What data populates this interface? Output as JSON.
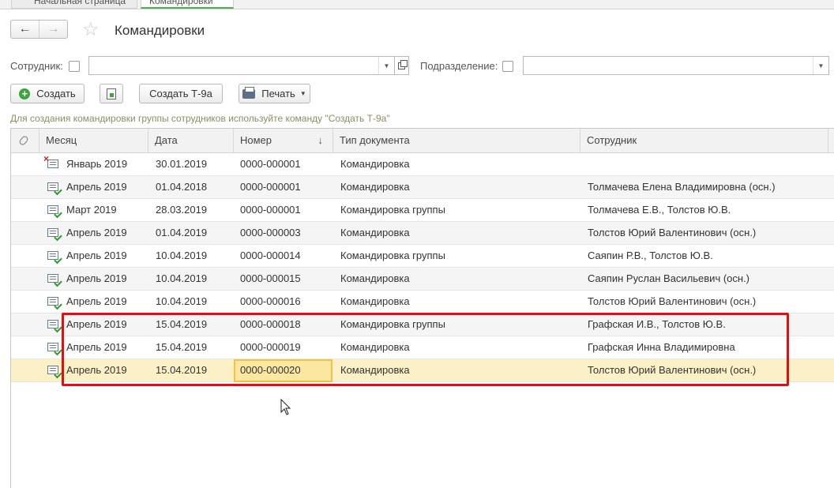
{
  "tabs": [
    {
      "label": "Начальная страница"
    },
    {
      "label": "Командировки"
    }
  ],
  "page": {
    "title": "Командировки"
  },
  "filters": {
    "employee_label": "Сотрудник:",
    "employee_value": "",
    "department_label": "Подразделение:",
    "department_value": ""
  },
  "toolbar": {
    "create_label": "Создать",
    "create_t9a_label": "Создать Т-9а",
    "print_label": "Печать"
  },
  "hint": "Для создания командировки группы сотрудников используйте команду \"Создать Т-9а\"",
  "table": {
    "columns": [
      "Месяц",
      "Дата",
      "Номер",
      "Тип документа",
      "Сотрудник"
    ],
    "rows": [
      {
        "icon": "document-deleted-icon",
        "month": "Январь 2019",
        "date": "30.01.2019",
        "number": "0000-000001",
        "type": "Командировка",
        "employee": ""
      },
      {
        "icon": "document-posted-icon",
        "month": "Апрель 2019",
        "date": "01.04.2018",
        "number": "0000-000001",
        "type": "Командировка",
        "employee": "Толмачева Елена Владимировна  (осн.)"
      },
      {
        "icon": "document-posted-icon",
        "month": "Март 2019",
        "date": "28.03.2019",
        "number": "0000-000001",
        "type": "Командировка группы",
        "employee": "Толмачева Е.В., Толстов Ю.В."
      },
      {
        "icon": "document-posted-icon",
        "month": "Апрель 2019",
        "date": "01.04.2019",
        "number": "0000-000003",
        "type": "Командировка",
        "employee": "Толстов Юрий Валентинович  (осн.)"
      },
      {
        "icon": "document-posted-icon",
        "month": "Апрель 2019",
        "date": "10.04.2019",
        "number": "0000-000014",
        "type": "Командировка группы",
        "employee": "Саяпин Р.В., Толстов Ю.В."
      },
      {
        "icon": "document-posted-icon",
        "month": "Апрель 2019",
        "date": "10.04.2019",
        "number": "0000-000015",
        "type": "Командировка",
        "employee": "Саяпин Руслан Васильевич  (осн.)"
      },
      {
        "icon": "document-posted-icon",
        "month": "Апрель 2019",
        "date": "10.04.2019",
        "number": "0000-000016",
        "type": "Командировка",
        "employee": "Толстов Юрий Валентинович  (осн.)"
      },
      {
        "icon": "document-posted-icon",
        "month": "Апрель 2019",
        "date": "15.04.2019",
        "number": "0000-000018",
        "type": "Командировка группы",
        "employee": "Графская И.В., Толстов Ю.В."
      },
      {
        "icon": "document-posted-icon",
        "month": "Апрель 2019",
        "date": "15.04.2019",
        "number": "0000-000019",
        "type": "Командировка",
        "employee": "Графская Инна Владимировна"
      },
      {
        "icon": "document-posted-icon",
        "month": "Апрель 2019",
        "date": "15.04.2019",
        "number": "0000-000020",
        "type": "Командировка",
        "employee": "Толстов Юрий Валентинович  (осн.)"
      }
    ]
  },
  "colors": {
    "selected_row": "#fbf0c6",
    "selected_cell": "#fbe7a0",
    "annotation": "#e01010",
    "hint_text": "#8d8d63"
  }
}
